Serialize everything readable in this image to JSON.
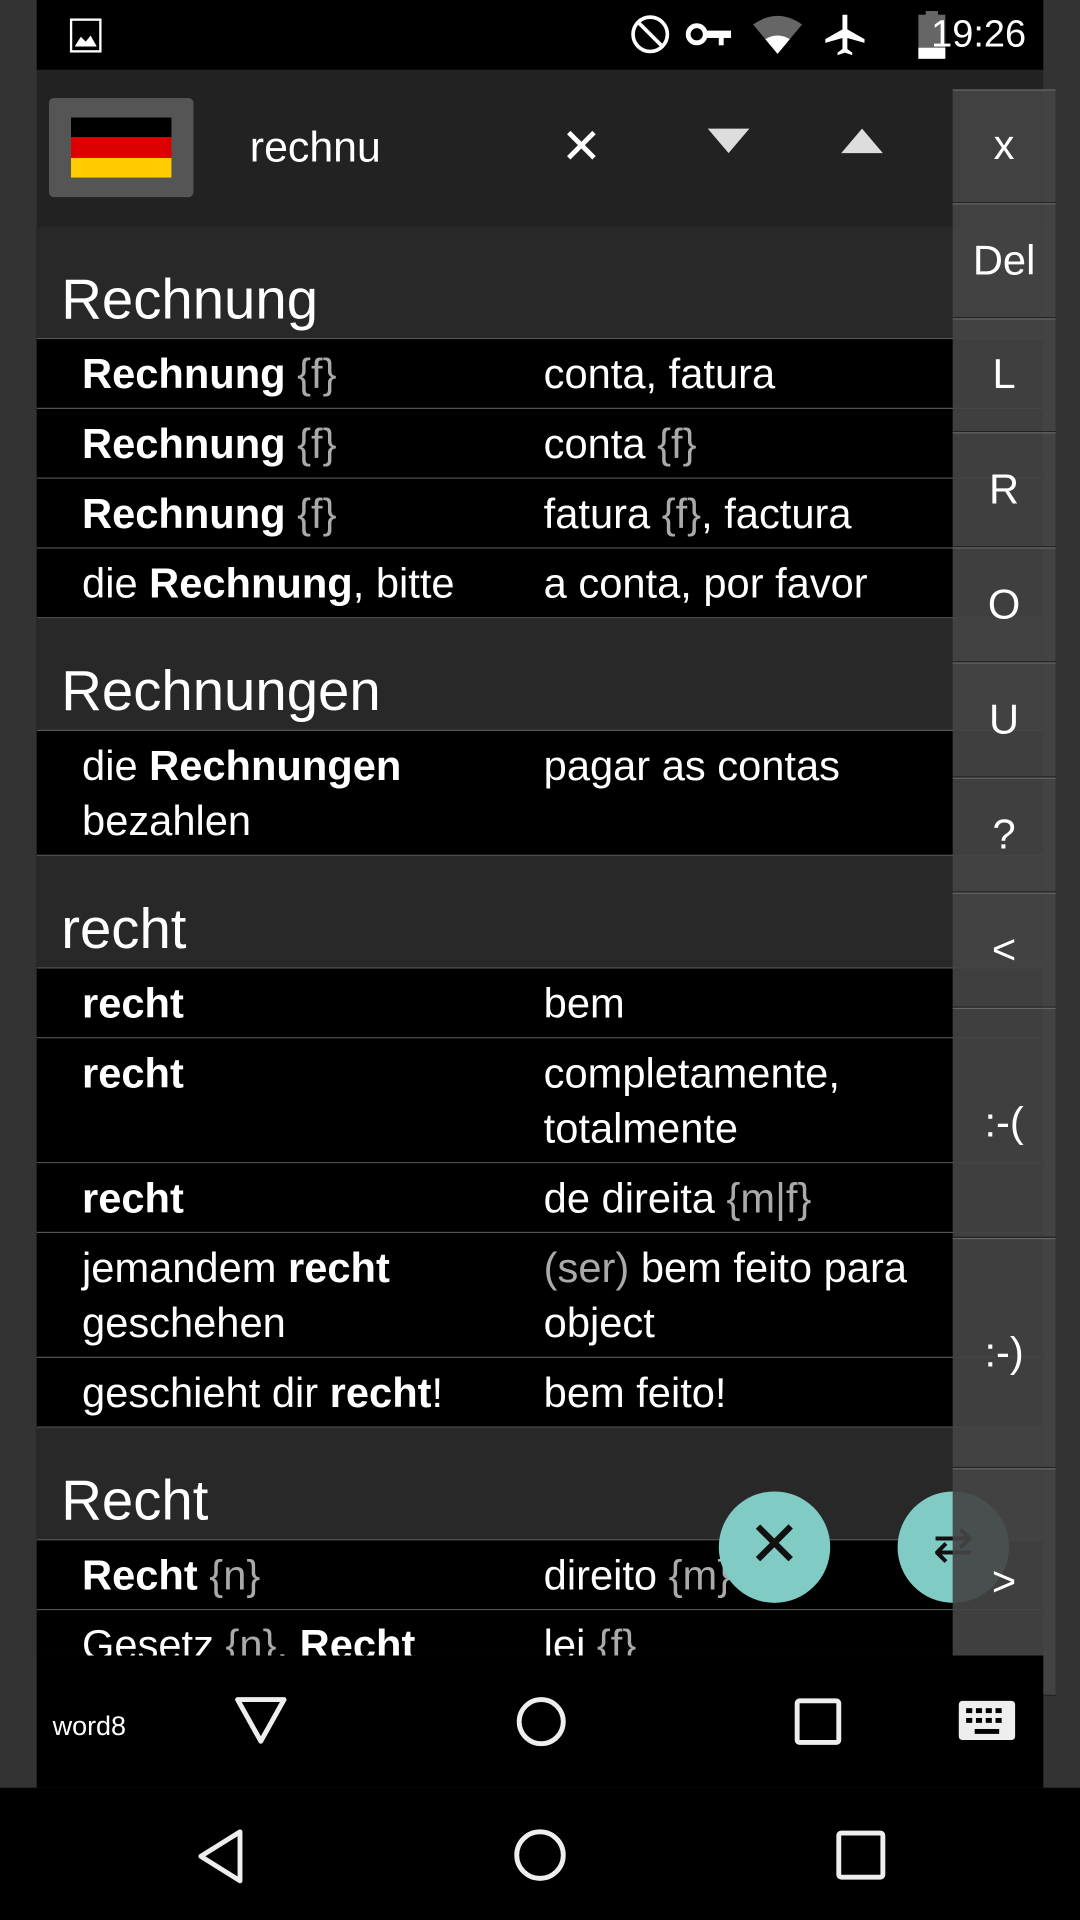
{
  "status_bar": {
    "time": "19:26",
    "icons": [
      "image-icon",
      "do-not-disturb-icon",
      "vpn-key-icon",
      "wifi-icon",
      "airplane-icon",
      "battery-icon"
    ]
  },
  "header": {
    "language_flag": "german-flag",
    "search_value": "rechnu",
    "clear_label": "✕",
    "prev_icon": "triangle-down-icon",
    "next_icon": "triangle-up-icon"
  },
  "colors": {
    "fab": "#80cbc4",
    "flag_black": "#000000",
    "flag_red": "#dd0000",
    "flag_gold": "#ffcc00"
  },
  "sections": [
    {
      "title": "Rechnung",
      "rows": [
        {
          "de": [
            {
              "t": "Rechnung",
              "s": "b"
            },
            {
              "t": " {f}",
              "s": "g"
            }
          ],
          "pt": [
            {
              "t": "conta, fatura",
              "s": ""
            }
          ]
        },
        {
          "de": [
            {
              "t": "Rechnung",
              "s": "b"
            },
            {
              "t": " {f}",
              "s": "g"
            }
          ],
          "pt": [
            {
              "t": "conta ",
              "s": ""
            },
            {
              "t": "{f}",
              "s": "g"
            }
          ]
        },
        {
          "de": [
            {
              "t": "Rechnung",
              "s": "b"
            },
            {
              "t": " {f}",
              "s": "g"
            }
          ],
          "pt": [
            {
              "t": "fatura ",
              "s": ""
            },
            {
              "t": "{f}",
              "s": "g"
            },
            {
              "t": ", factura",
              "s": ""
            }
          ]
        },
        {
          "de": [
            {
              "t": "die ",
              "s": ""
            },
            {
              "t": "Rechnung",
              "s": "b"
            },
            {
              "t": ", bitte",
              "s": ""
            }
          ],
          "pt": [
            {
              "t": "a conta, por favor",
              "s": ""
            }
          ]
        }
      ]
    },
    {
      "title": "Rechnungen",
      "rows": [
        {
          "de": [
            {
              "t": "die ",
              "s": ""
            },
            {
              "t": "Rechnungen",
              "s": "b"
            },
            {
              "t": " bezahlen",
              "s": ""
            }
          ],
          "pt": [
            {
              "t": "pagar as contas",
              "s": ""
            }
          ]
        }
      ]
    },
    {
      "title": "recht",
      "rows": [
        {
          "de": [
            {
              "t": "recht",
              "s": "b"
            }
          ],
          "pt": [
            {
              "t": "bem",
              "s": ""
            }
          ]
        },
        {
          "de": [
            {
              "t": "recht",
              "s": "b"
            }
          ],
          "pt": [
            {
              "t": "completamente,\ntotalmente",
              "s": ""
            }
          ]
        },
        {
          "de": [
            {
              "t": "recht",
              "s": "b"
            }
          ],
          "pt": [
            {
              "t": "de direita ",
              "s": ""
            },
            {
              "t": "{m|f}",
              "s": "g"
            }
          ]
        },
        {
          "de": [
            {
              "t": "jemandem ",
              "s": ""
            },
            {
              "t": "recht",
              "s": "b"
            },
            {
              "t": " geschehen",
              "s": ""
            }
          ],
          "pt": [
            {
              "t": "(ser)",
              "s": "g"
            },
            {
              "t": " bem feito para\nobject",
              "s": ""
            }
          ]
        },
        {
          "de": [
            {
              "t": "geschieht dir ",
              "s": ""
            },
            {
              "t": "recht",
              "s": "b"
            },
            {
              "t": "!",
              "s": ""
            }
          ],
          "pt": [
            {
              "t": "bem feito!",
              "s": ""
            }
          ]
        }
      ]
    },
    {
      "title": "Recht",
      "rows": [
        {
          "de": [
            {
              "t": "Recht",
              "s": "b"
            },
            {
              "t": " {n}",
              "s": "g"
            }
          ],
          "pt": [
            {
              "t": "direito ",
              "s": ""
            },
            {
              "t": "{m}",
              "s": "g"
            }
          ]
        },
        {
          "de": [
            {
              "t": "Gesetz ",
              "s": ""
            },
            {
              "t": "{n}",
              "s": "g"
            },
            {
              "t": ", ",
              "s": ""
            },
            {
              "t": "Recht",
              "s": "b"
            }
          ],
          "pt": [
            {
              "t": "lei ",
              "s": ""
            },
            {
              "t": "{f}",
              "s": "g"
            }
          ]
        }
      ]
    }
  ],
  "key_panel": [
    "x",
    "Del",
    "L",
    "R",
    "O",
    "U",
    "?",
    "<",
    ":-(",
    ":-)",
    ">"
  ],
  "fab": {
    "clear_icon": "close-icon",
    "swap_icon": "swap-arrows-icon"
  },
  "keyboard_bar": {
    "label": "word8"
  },
  "nav": {
    "icons": [
      "back-icon",
      "home-icon",
      "recents-icon"
    ]
  }
}
